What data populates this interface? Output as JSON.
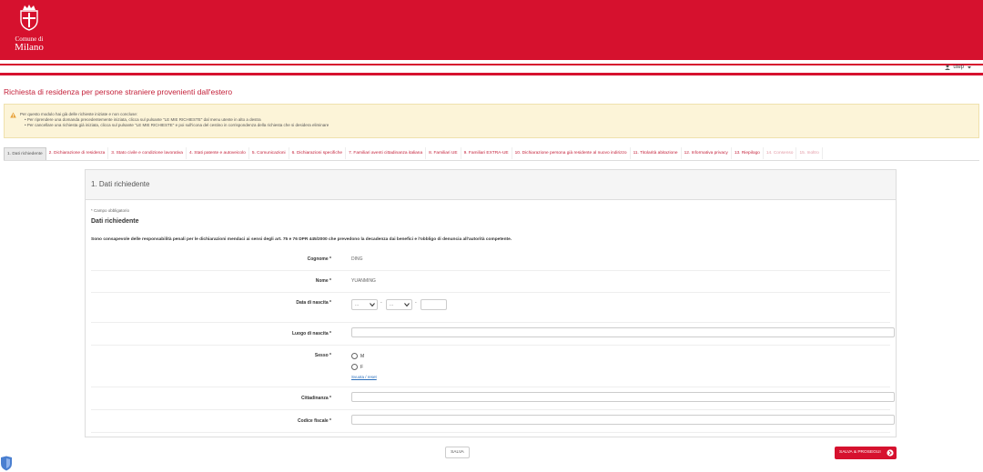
{
  "header": {
    "logo_line1": "Comune di",
    "logo_line2": "Milano",
    "brand_color": "#d6112e"
  },
  "user": {
    "name": "utep"
  },
  "page_title": "Richiesta di residenza per persone straniere provenienti dall'estero",
  "alert": {
    "line1": "Per questo modulo hai già delle richieste iniziate e non concluse:",
    "line2": "• Per riprendere una domanda precedentemente iniziata, clicca sul pulsante \"LE MIE RICHIESTE\" dal menu utente in alto a destra",
    "line3": "• Per cancellare una richiesta già iniziata, clicca sul pulsante \"LE MIE RICHIESTE\" e poi sull'icona del cestino in corrispondenza della richiesta che si desidera eliminare"
  },
  "steps": [
    "1. Dati richiedente",
    "2. Dichiarazione di residenza",
    "3. Stato civile e condizione lavorativa",
    "4. Stati patente e autoveicolo",
    "5. Comunicazioni",
    "6. Dichiarazioni specifiche",
    "7. Familiari aventi cittadinanza italiana",
    "8. Familiari UE",
    "9. Familiari EXTRA-UE",
    "10. Dichiarazione persona già residente al nuovo indirizzo",
    "11. Titolarità abitazione",
    "12. Informativa privacy",
    "13. Riepilogo",
    "14. Consenso",
    "15. Inoltro"
  ],
  "panel": {
    "title": "1. Dati richiedente",
    "required_note": "* Campo obbligatorio",
    "section_title": "Dati richiedente",
    "disclaimer": "Sono consapevole delle responsabilità penali per le dichiarazioni mendaci ai sensi degli art. 75 e 76 DPR 445/2000 che prevedono la decadenza dai benefici e l'obbligo di denuncia all'autorità competente."
  },
  "fields": {
    "cognome": {
      "label": "Cognome *",
      "value": "DING"
    },
    "nome": {
      "label": "Nome *",
      "value": "YUANMING"
    },
    "data_nascita": {
      "label": "Data di nascita *",
      "day": "...",
      "month": "...",
      "year": ""
    },
    "luogo_nascita": {
      "label": "Luogo di nascita *",
      "value": ""
    },
    "sesso": {
      "label": "Sesso *",
      "option_m": "M",
      "option_f": "F",
      "reset": "Svuota / reset"
    },
    "cittadinanza": {
      "label": "Cittadinanza *",
      "value": ""
    },
    "codice_fiscale": {
      "label": "Codice fiscale *",
      "value": ""
    }
  },
  "buttons": {
    "save": "SALVA",
    "save_next": "SALVA & PROSEGUI"
  }
}
